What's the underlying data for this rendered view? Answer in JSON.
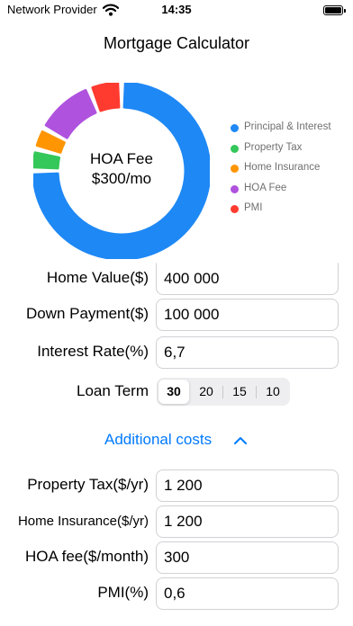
{
  "status_bar": {
    "carrier": "Network Provider",
    "time": "14:35"
  },
  "title": "Mortgage Calculator",
  "chart_data": {
    "type": "pie",
    "donut": true,
    "center_label_line1": "HOA Fee",
    "center_label_line2": "$300/mo",
    "series": [
      {
        "name": "Principal & Interest",
        "value": 75,
        "color": "#1e88f5"
      },
      {
        "name": "Property Tax",
        "value": 4,
        "color": "#34c759"
      },
      {
        "name": "Home Insurance",
        "value": 4,
        "color": "#ff9500"
      },
      {
        "name": "HOA Fee",
        "value": 11,
        "color": "#af52de"
      },
      {
        "name": "PMI",
        "value": 6,
        "color": "#ff3b30"
      }
    ]
  },
  "inputs": {
    "home_value": {
      "label": "Home Value($)",
      "value": "400 000"
    },
    "down_payment": {
      "label": "Down Payment($)",
      "value": "100 000"
    },
    "interest_rate": {
      "label": "Interest Rate(%)",
      "value": "6,7"
    },
    "loan_term": {
      "label": "Loan Term",
      "options": [
        "30",
        "20",
        "15",
        "10"
      ],
      "selected": "30"
    }
  },
  "additional": {
    "label": "Additional costs",
    "expanded": true
  },
  "costs": {
    "property_tax": {
      "label": "Property Tax($/yr)",
      "value": "1 200"
    },
    "home_insurance": {
      "label": "Home Insurance($/yr)",
      "value": "1 200"
    },
    "hoa_fee": {
      "label": "HOA fee($/month)",
      "value": "300"
    },
    "pmi": {
      "label": "PMI(%)",
      "value": "0,6"
    }
  },
  "colors": {
    "accent": "#007aff"
  }
}
